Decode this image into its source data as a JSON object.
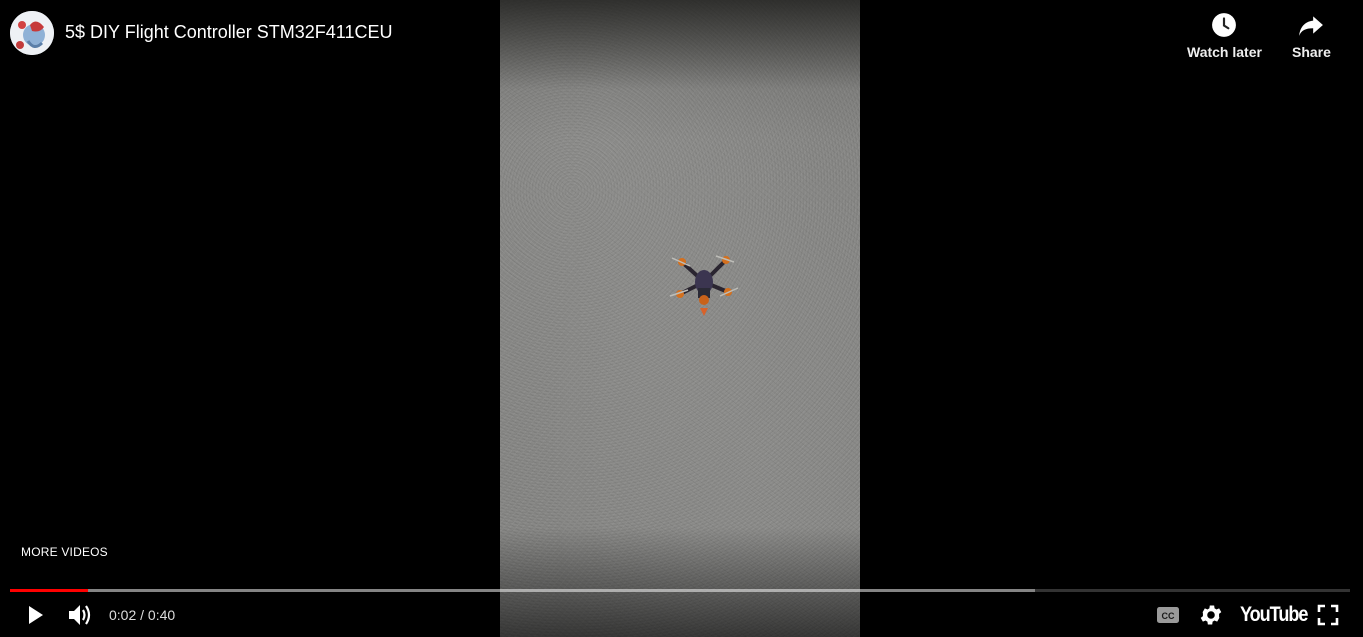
{
  "video": {
    "title": "5$ DIY Flight Controller STM32F411CEU",
    "progress_played_fraction": 0.058,
    "progress_buffered_fraction": 0.765
  },
  "top_actions": {
    "watch_later_label": "Watch later",
    "share_label": "Share"
  },
  "overlay": {
    "more_videos_label": "MORE VIDEOS"
  },
  "controls": {
    "time": "0:02 / 0:40",
    "logo_text": "YouTube"
  },
  "colors": {
    "accent": "#ff0000",
    "text": "#ffffff"
  },
  "icons": [
    "clock-icon",
    "share-arrow-icon",
    "play-icon",
    "volume-icon",
    "captions-icon",
    "gear-icon",
    "fullscreen-icon"
  ]
}
